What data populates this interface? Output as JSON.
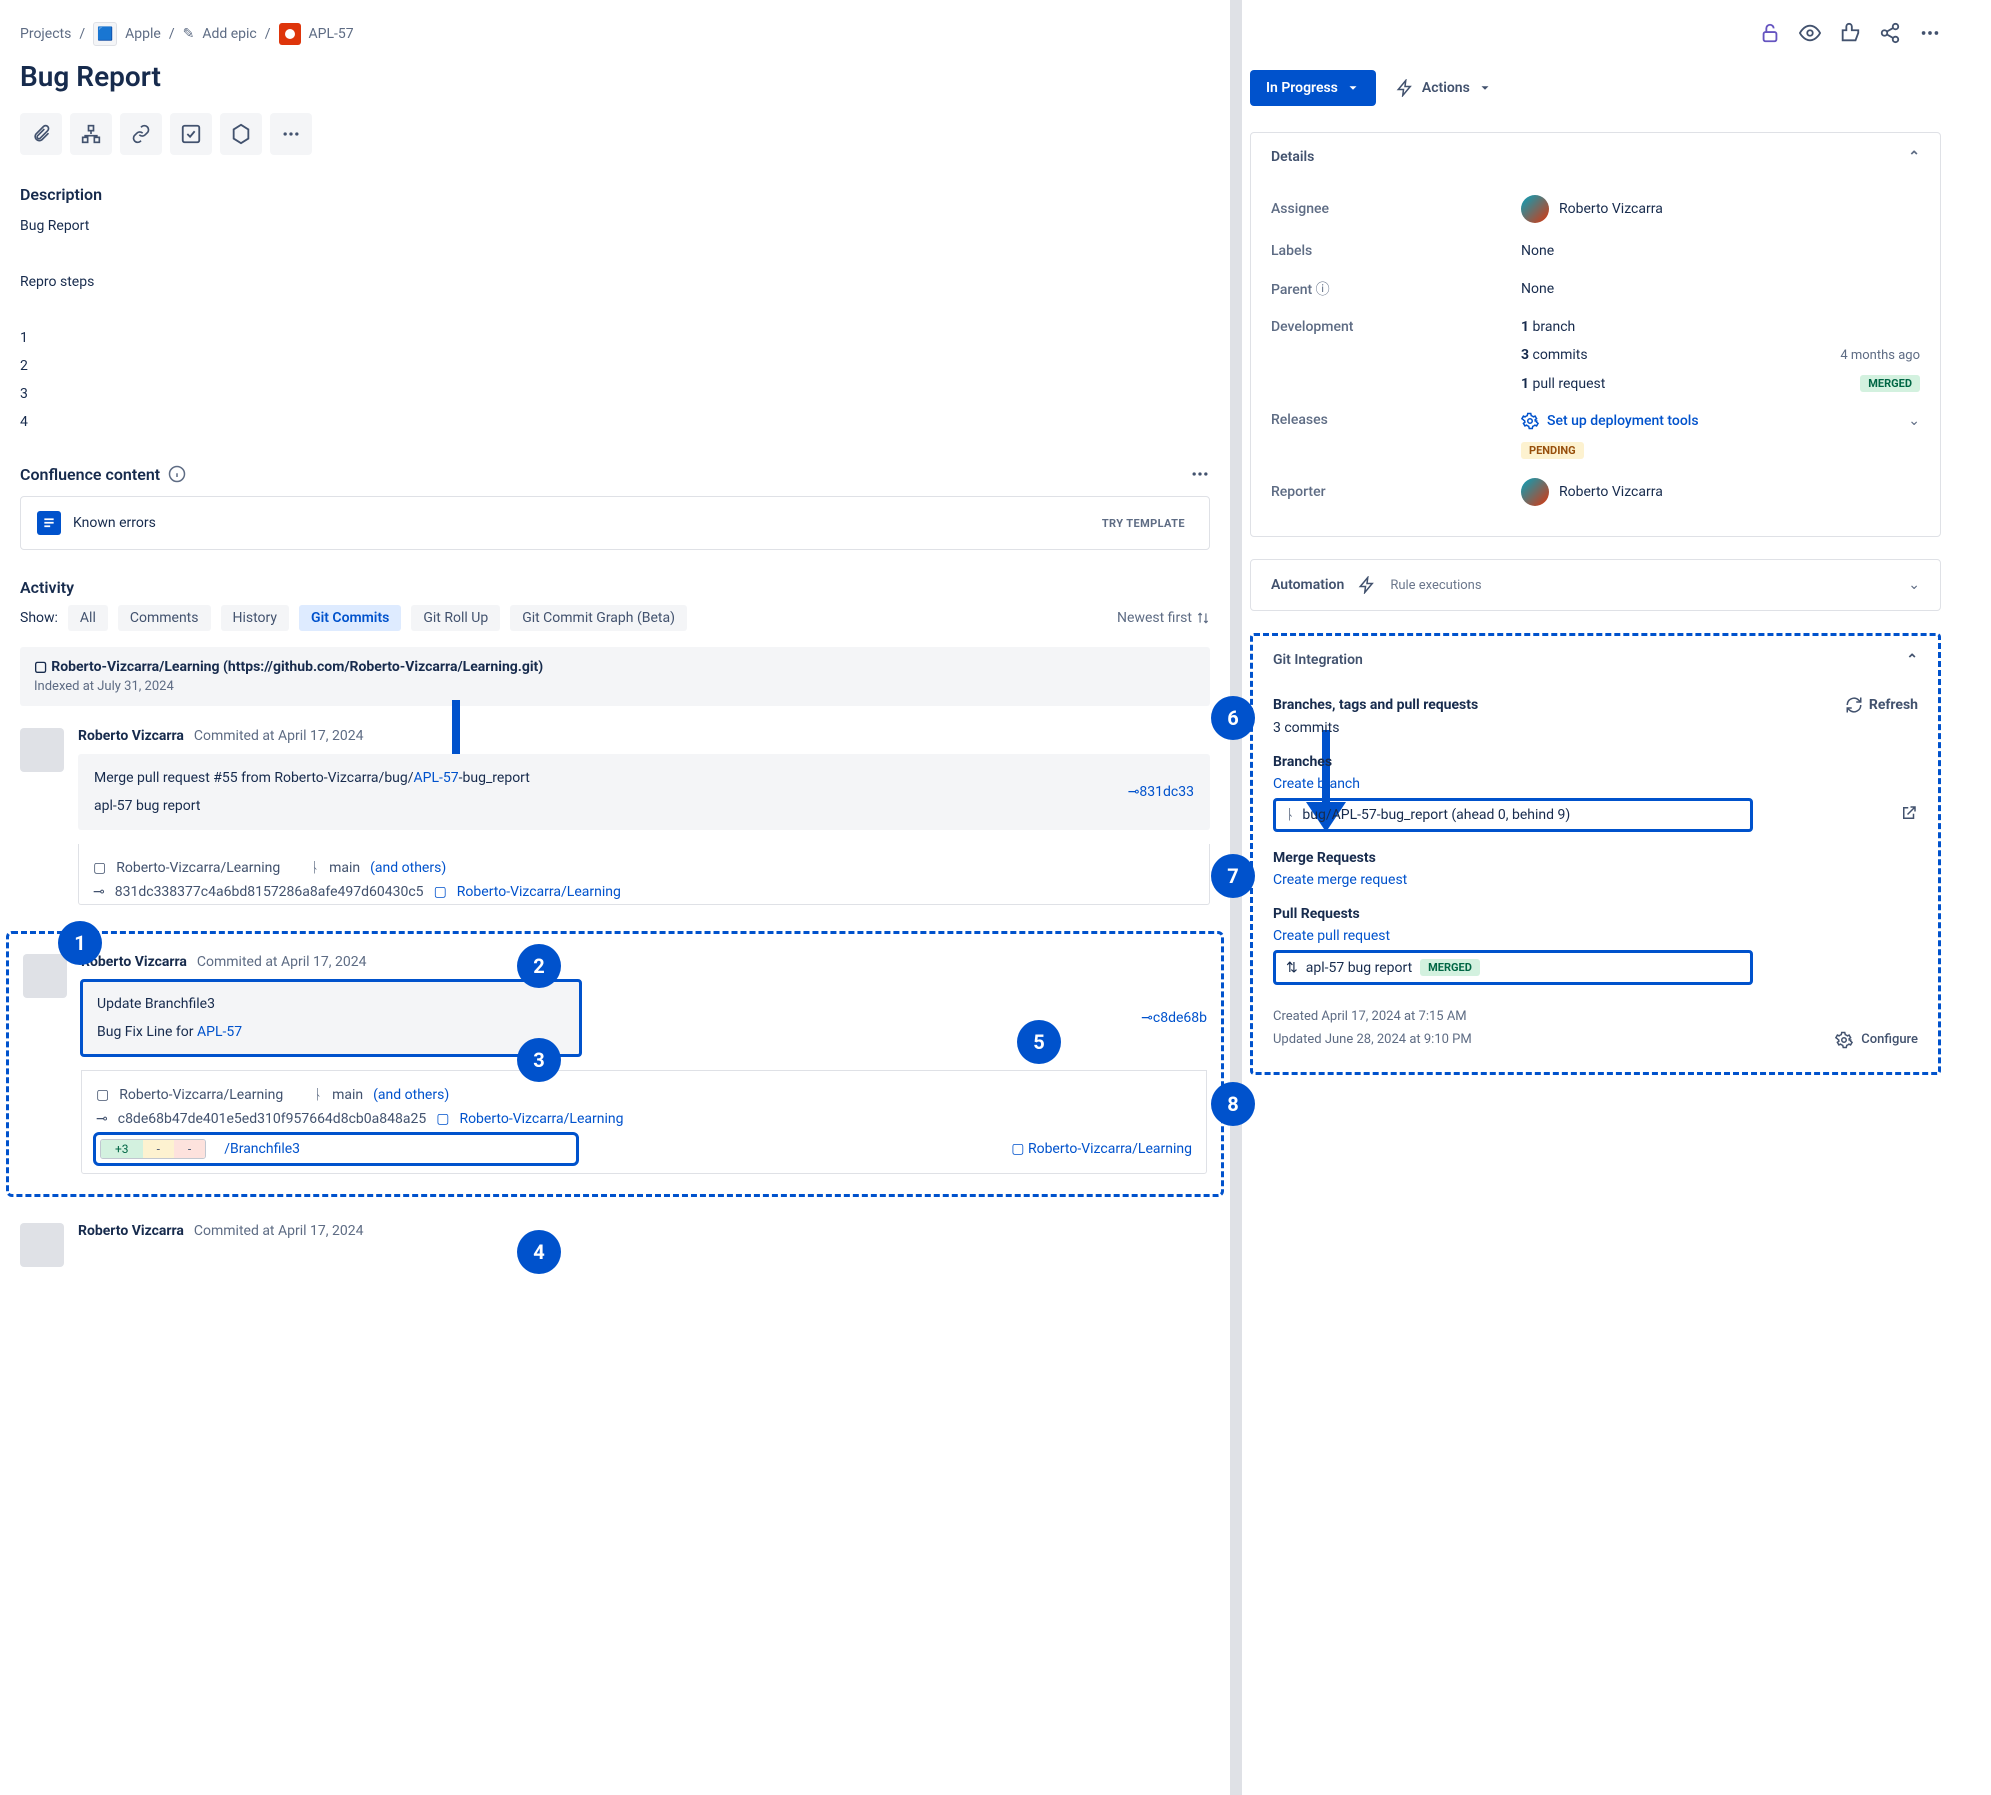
{
  "crumbs": {
    "projects": "Projects",
    "project": "Apple",
    "add_epic": "Add epic",
    "issue_key": "APL-57"
  },
  "title": "Bug Report",
  "description": {
    "heading": "Description",
    "body": "Bug Report",
    "repro_head": "Repro steps",
    "steps": [
      "1",
      "2",
      "3",
      "4"
    ]
  },
  "confluence": {
    "heading": "Confluence content",
    "card": "Known errors",
    "try": "TRY TEMPLATE"
  },
  "activity": {
    "heading": "Activity",
    "show": "Show:",
    "tabs": {
      "all": "All",
      "comments": "Comments",
      "history": "History",
      "git_commits": "Git Commits",
      "git_rollup": "Git Roll Up",
      "git_graph": "Git Commit Graph (Beta)"
    },
    "newest": "Newest first"
  },
  "repo_banner": {
    "title": "Roberto-Vizcarra/Learning (https://github.com/Roberto-Vizcarra/Learning.git)",
    "indexed": "Indexed at July 31, 2024"
  },
  "commits": [
    {
      "author": "Roberto Vizcarra",
      "at": "Commited at April 17, 2024",
      "msg_line1": "Merge pull request #55 from Roberto-Vizcarra/bug/",
      "msg_link": "APL-57",
      "msg_line1b": "-bug_report",
      "msg_line2": "apl-57 bug report",
      "hash_short": "831dc33",
      "repo": "Roberto-Vizcarra/Learning",
      "branch": "main",
      "others": "(and others)",
      "hash_full": "831dc338377c4a6bd8157286a8afe497d60430c5",
      "repo_link": "Roberto-Vizcarra/Learning"
    },
    {
      "author": "Roberto Vizcarra",
      "at": "Commited at April 17, 2024",
      "msg_line1": "Update Branchfile3",
      "msg_line2": "Bug Fix Line for ",
      "msg_link": "APL-57",
      "hash_short": "c8de68b",
      "repo": "Roberto-Vizcarra/Learning",
      "branch": "main",
      "others": "(and others)",
      "hash_full": "c8de68b47de401e5ed310f957664d8cb0a848a25",
      "repo_link": "Roberto-Vizcarra/Learning",
      "file": "/Branchfile3",
      "added": "+3",
      "mod": "-",
      "del": "-"
    },
    {
      "author": "Roberto Vizcarra",
      "at": "Commited at April 17, 2024"
    }
  ],
  "right": {
    "status": "In Progress",
    "actions": "Actions",
    "details": {
      "heading": "Details",
      "assignee_lbl": "Assignee",
      "assignee": "Roberto Vizcarra",
      "labels_lbl": "Labels",
      "labels": "None",
      "parent_lbl": "Parent",
      "parent": "None",
      "dev_lbl": "Development",
      "branches": "1",
      "branches_w": " branch",
      "commits": "3",
      "commits_w": " commits",
      "commits_ts": "4 months ago",
      "prs": "1",
      "prs_w": " pull request",
      "merged": "MERGED",
      "releases_lbl": "Releases",
      "setup": "Set up deployment tools",
      "pending": "PENDING",
      "reporter_lbl": "Reporter",
      "reporter": "Roberto Vizcarra"
    },
    "automation": {
      "label": "Automation",
      "rule": "Rule executions"
    },
    "gi": {
      "heading": "Git Integration",
      "sub": "Branches, tags and pull requests",
      "refresh": "Refresh",
      "commits": "3 commits",
      "branches_h": "Branches",
      "create_branch": "Create branch",
      "branch": "bug/APL-57-bug_report (ahead 0, behind 9)",
      "mr_h": "Merge Requests",
      "create_mr": "Create merge request",
      "pr_h": "Pull Requests",
      "create_pr": "Create pull request",
      "pr": "apl-57 bug report",
      "merged": "MERGED",
      "created": "Created April 17, 2024 at 7:15 AM",
      "updated": "Updated June 28, 2024 at 9:10 PM",
      "configure": "Configure"
    }
  },
  "bubbles": {
    "b1": "1",
    "b2": "2",
    "b3": "3",
    "b4": "4",
    "b5": "5",
    "b6": "6",
    "b7": "7",
    "b8": "8"
  }
}
